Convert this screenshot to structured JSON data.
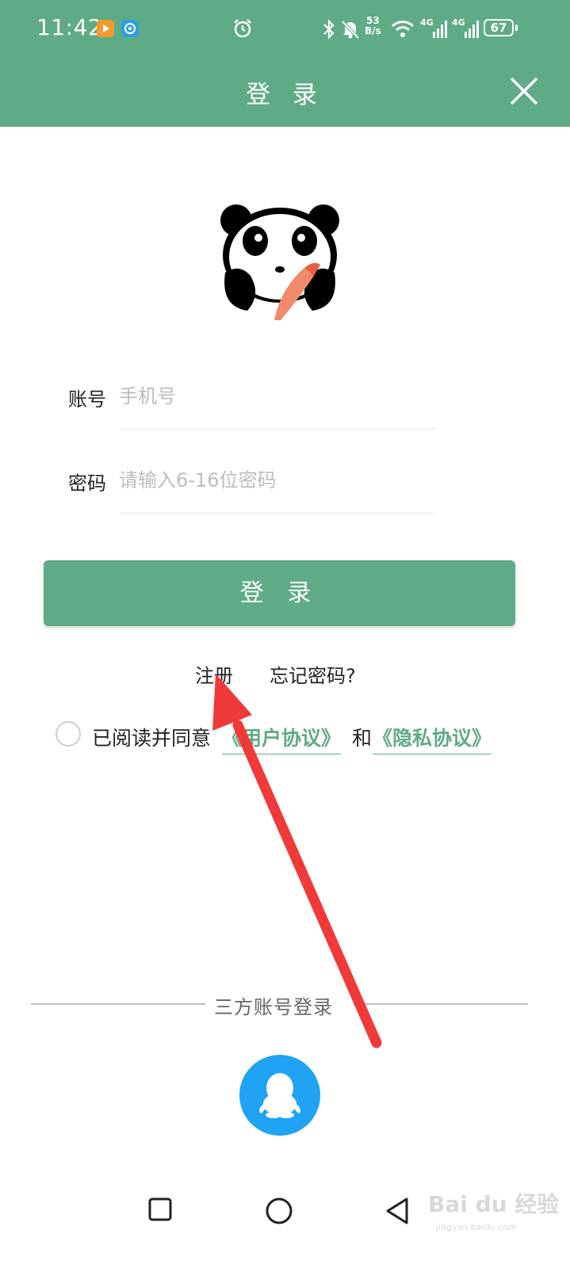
{
  "status_bar": {
    "time": "11:42",
    "net_speed_value": "53",
    "net_speed_unit": "B/s",
    "battery": "67",
    "signal_1_label": "4G",
    "signal_2_label": "4G"
  },
  "header": {
    "title": "登 录"
  },
  "form": {
    "account_label": "账号",
    "account_placeholder": "手机号",
    "password_label": "密码",
    "password_placeholder": "请输入6-16位密码",
    "login_button": "登 录"
  },
  "links": {
    "register": "注册",
    "forgot_password": "忘记密码?"
  },
  "agreement": {
    "prefix": "已阅读并同意",
    "user_agreement": "《用户协议》",
    "conjunction": "和",
    "privacy_policy": "《隐私协议》"
  },
  "third_party": {
    "label": "三方账号登录",
    "qq_icon": "qq-icon"
  },
  "watermark": {
    "brand": "Bai du 经验",
    "url": "jingyan.baidu.com"
  },
  "colors": {
    "accent": "#5fab85",
    "qq_blue": "#1fa3f2",
    "annotation_arrow": "#f03a3a"
  }
}
